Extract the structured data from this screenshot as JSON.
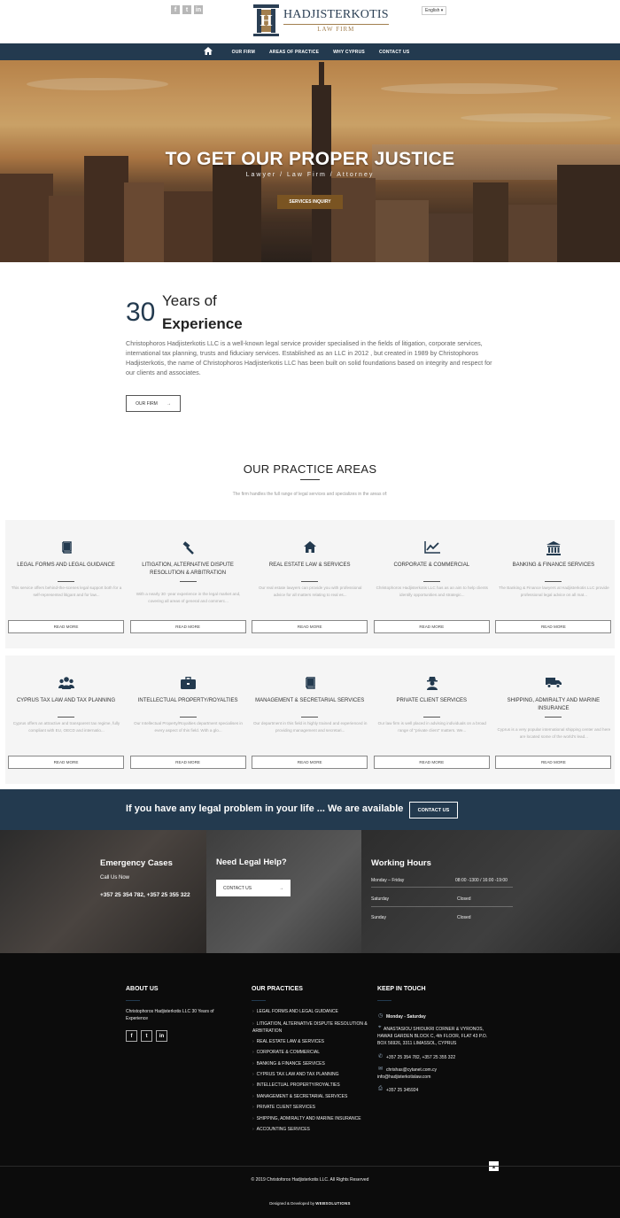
{
  "header": {
    "social": [
      "f",
      "t",
      "in"
    ],
    "logo_name": "HADJISTERKOTIS",
    "logo_sub": "LAW FIRM",
    "language": "English ▾"
  },
  "nav": {
    "home_icon": "home-icon",
    "items": [
      "OUR FIRM",
      "AREAS OF PRACTICE",
      "WHY CYPRUS",
      "CONTACT US"
    ]
  },
  "hero": {
    "title": "TO GET OUR PROPER JUSTICE",
    "subtitle": "Lawyer / Law Firm / Attorney",
    "button": "SERVICES INQUIRY"
  },
  "experience": {
    "number": "30",
    "title_line1": "Years of",
    "title_line2": "Experience",
    "paragraph": "Christophoros Hadjisterkotis LLC is a well-known legal service provider specialised in the fields of litigation, corporate services, international tax planning, trusts and fiduciary services. Established as an LLC in 2012 , but created in 1989 by Christophoros Hadjisterkotis, the name of Christophoros Hadjisterkotis LLC  has been built on solid foundations based on integrity and respect for our clients and associates.",
    "button": "OUR FIRM",
    "button_arrow": "→"
  },
  "practice": {
    "title": "OUR PRACTICE AREAS",
    "subtitle": "The firm handles the full range of legal services and specializes in the areas of:",
    "read_more": "READ MORE",
    "cards": [
      {
        "icon": "book-icon",
        "title": "LEGAL FORMS AND LEGAL GUIDANCE",
        "desc": "This service offers behind-the-scenes legal support both for a self-represented litigant and for law..."
      },
      {
        "icon": "gavel-icon",
        "title": "LITIGATION, ALTERNATIVE DISPUTE RESOLUTION & ARBITRATION",
        "desc": "With a nearly 30 -year experience in the legal market and, covering all areas of general and commerc..."
      },
      {
        "icon": "home-icon",
        "title": "REAL ESTATE LAW & SERVICES",
        "desc": "Our real estate lawyers can provide you with professional advice for all matters relating to real es..."
      },
      {
        "icon": "line-chart-icon",
        "title": "CORPORATE & COMMERCIAL",
        "desc": "Christophoros Hadjisterkotis LLC has as an aim to help clients identify opportunities and strategic..."
      },
      {
        "icon": "bank-icon",
        "title": "BANKING & FINANCE SERVICES",
        "desc": "The Banking & Finance lawyers at Hadjisterkotis LLC provide professional legal advice on all mat..."
      },
      {
        "icon": "users-icon",
        "title": "CYPRUS TAX LAW AND TAX PLANNING",
        "desc": "Cyprus offers an attractive and transparent tax regime, fully compliant with EU, OECD and internatio..."
      },
      {
        "icon": "briefcase-icon",
        "title": "INTELLECTUAL PROPERTY/ROYALTIES",
        "desc": "Our Intellectual Property/Royalties department specialises in every aspect of this field. With a glo..."
      },
      {
        "icon": "book-icon",
        "title": "MANAGEMENT & SECRETARIAL SERVICES",
        "desc": "Our department in this field is highly trained and experienced in providing management and secretari..."
      },
      {
        "icon": "user-secret-icon",
        "title": "PRIVATE CLIENT SERVICES",
        "desc": "Our law firm is well placed in advising individuals on a broad range of \"private client\" matters. We..."
      },
      {
        "icon": "truck-icon",
        "title": "SHIPPING, ADMIRALTY AND MARINE INSURANCE",
        "desc": "Cyprus is a very popular international shipping center and here are located some of the world's lead..."
      }
    ]
  },
  "cta": {
    "text": "If you have any legal problem in your life ... We are available",
    "button": "CONTACT US"
  },
  "info": {
    "emergency_title": "Emergency Cases",
    "call_label": "Call Us Now",
    "phones": "+357 25 354 782,  +357 25 355 322",
    "help_title": "Need Legal Help?",
    "help_button": "CONTACT US",
    "help_arrow": "→",
    "hours_title": "Working Hours",
    "hours": [
      {
        "day": "Monday – Friday",
        "time": "08:00 -1300 / 16:00 -19:00"
      },
      {
        "day": "Saturday",
        "time": "Closed"
      },
      {
        "day": "Sunday",
        "time": "Closed"
      }
    ]
  },
  "footer": {
    "about_title": "ABOUT US",
    "about_text": "Christophoros Hadjisterkotis LLC 30 Years of Experience",
    "social": [
      "f",
      "t",
      "in"
    ],
    "practices_title": "OUR PRACTICES",
    "practices": [
      "LEGAL FORMS AND LEGAL GUIDANCE",
      "LITIGATION, ALTERNATIVE DISPUTE RESOLUTION & ARBITRATION",
      "REAL ESTATE LAW & SERVICES",
      "CORPORATE & COMMERCIAL",
      "BANKING & FINANCE SERVICES",
      "CYPRUS TAX LAW AND TAX PLANNING",
      "INTELLECTUAL PROPERTY/ROYALTIES",
      "MANAGEMENT & SECRETARIAL SERVICES",
      "PRIVATE CLIENT SERVICES",
      "SHIPPING, ADMIRALTY AND MARINE INSURANCE",
      "ACCOUNTING SERVICES"
    ],
    "touch_title": "KEEP IN TOUCH",
    "days": "Monday - Saturday",
    "address": "ANASTASIOU SHIOUKRI CORNER & VYRONOS, HAWAII GARDEN BLOCK C, 4th FLOOR, FLAT 43 P.O. BOX 56926, 3311 LIMASSOL, CYPRUS",
    "phone": "+357 25 354 782, +357 25 355 322",
    "email1": "chrishas@cytanet.com.cy",
    "email2": "info@hadjisterkotislaw.com",
    "fax": "+357 25 345924",
    "copyright": "© 2019 Christoforos Hadjisterkotis LLC. All Rights Reserved",
    "designed_by": "Designed & Developed by ",
    "designer": "WEBSOLUTIONS",
    "to_top": "▴"
  }
}
